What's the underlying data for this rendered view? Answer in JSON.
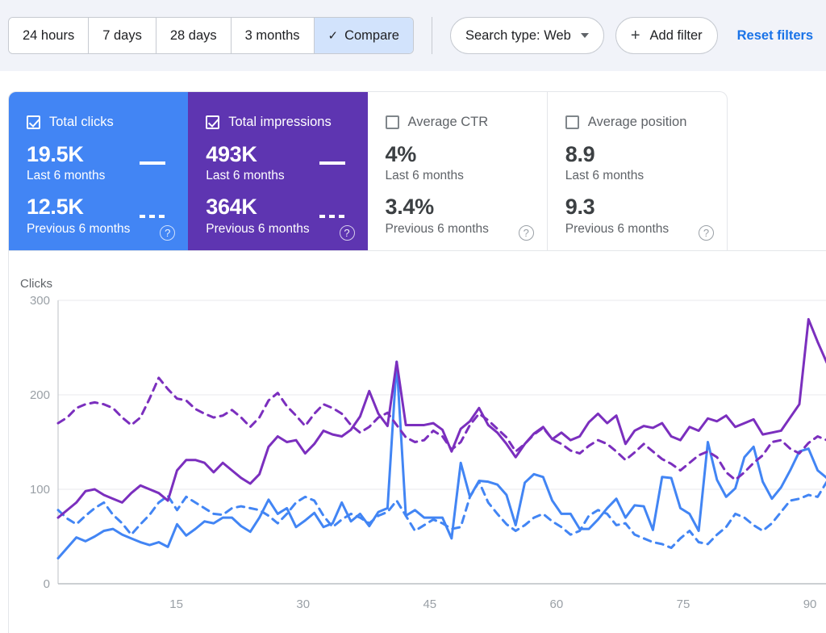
{
  "toolbar": {
    "ranges": [
      {
        "label": "24 hours",
        "active": false
      },
      {
        "label": "7 days",
        "active": false
      },
      {
        "label": "28 days",
        "active": false
      },
      {
        "label": "3 months",
        "active": false
      }
    ],
    "compare_label": "Compare",
    "compare_check_glyph": "✓",
    "search_type_label": "Search type: Web",
    "add_filter_label": "Add filter",
    "add_filter_glyph": "+",
    "reset_label": "Reset filters"
  },
  "cards": [
    {
      "title": "Total clicks",
      "checked": true,
      "theme": "sel-blue",
      "current_value": "19.5K",
      "current_sub": "Last 6 months",
      "previous_value": "12.5K",
      "previous_sub": "Previous 6 months",
      "help_glyph": "?"
    },
    {
      "title": "Total impressions",
      "checked": true,
      "theme": "sel-purple",
      "current_value": "493K",
      "current_sub": "Last 6 months",
      "previous_value": "364K",
      "previous_sub": "Previous 6 months",
      "help_glyph": "?"
    },
    {
      "title": "Average CTR",
      "checked": false,
      "theme": "plain",
      "current_value": "4%",
      "current_sub": "Last 6 months",
      "previous_value": "3.4%",
      "previous_sub": "Previous 6 months",
      "help_glyph": "?"
    },
    {
      "title": "Average position",
      "checked": false,
      "theme": "plain",
      "current_value": "8.9",
      "current_sub": "Last 6 months",
      "previous_value": "9.3",
      "previous_sub": "Previous 6 months",
      "help_glyph": "?"
    }
  ],
  "colors": {
    "clicks": "#4285f4",
    "impressions": "#7b2fbe",
    "card_blue": "#4285f4",
    "card_purple": "#5e35b1",
    "accent_link": "#1a73e8",
    "compare_active_bg": "#d2e3fc",
    "toolbar_bg": "#f1f3f9",
    "gridline": "#e8eaed"
  },
  "chart_data": {
    "type": "line",
    "title": "",
    "ylabel": "Clicks",
    "xlabel": "",
    "ylim": [
      0,
      300
    ],
    "yticks": [
      0,
      100,
      200,
      300
    ],
    "xlim": [
      1,
      92
    ],
    "xticks": [
      15,
      30,
      45,
      60,
      75,
      90
    ],
    "grid": true,
    "legend_position": "cards-above",
    "series": [
      {
        "name": "Total clicks",
        "color": "#4285f4",
        "style": "solid",
        "values": [
          27,
          38,
          49,
          45,
          50,
          56,
          58,
          52,
          48,
          44,
          41,
          44,
          39,
          63,
          51,
          58,
          66,
          64,
          70,
          70,
          61,
          55,
          70,
          89,
          74,
          80,
          60,
          67,
          75,
          60,
          64,
          86,
          66,
          74,
          61,
          76,
          80,
          235,
          72,
          78,
          70,
          70,
          70,
          48,
          128,
          92,
          109,
          108,
          105,
          94,
          62,
          107,
          116,
          113,
          88,
          74,
          74,
          58,
          58,
          68,
          80,
          90,
          70,
          83,
          82,
          57,
          113,
          112,
          80,
          74,
          56,
          150,
          110,
          92,
          101,
          134,
          145,
          108,
          90,
          102,
          120,
          140,
          143,
          120,
          112
        ]
      },
      {
        "name": "Total clicks (previous period)",
        "color": "#4285f4",
        "style": "dashed",
        "values": [
          78,
          69,
          63,
          72,
          80,
          86,
          73,
          64,
          52,
          63,
          73,
          86,
          93,
          78,
          92,
          86,
          80,
          74,
          73,
          80,
          82,
          80,
          78,
          72,
          64,
          74,
          86,
          92,
          88,
          72,
          60,
          68,
          74,
          70,
          64,
          72,
          76,
          88,
          72,
          56,
          62,
          68,
          64,
          58,
          60,
          92,
          108,
          86,
          74,
          63,
          56,
          62,
          70,
          74,
          66,
          60,
          52,
          56,
          72,
          78,
          74,
          62,
          64,
          52,
          48,
          44,
          42,
          38,
          48,
          56,
          44,
          42,
          52,
          60,
          74,
          70,
          62,
          56,
          64,
          76,
          88,
          90,
          94,
          92,
          108
        ]
      },
      {
        "name": "Total impressions",
        "color": "#7b2fbe",
        "style": "solid",
        "values": [
          70,
          78,
          86,
          98,
          100,
          94,
          90,
          86,
          96,
          104,
          100,
          96,
          88,
          120,
          131,
          131,
          128,
          118,
          128,
          120,
          112,
          106,
          116,
          145,
          156,
          150,
          152,
          138,
          148,
          162,
          158,
          156,
          163,
          177,
          204,
          180,
          167,
          235,
          168,
          168,
          168,
          170,
          163,
          140,
          164,
          172,
          186,
          168,
          160,
          148,
          134,
          148,
          159,
          166,
          153,
          160,
          152,
          156,
          171,
          180,
          170,
          178,
          148,
          162,
          167,
          165,
          170,
          156,
          152,
          166,
          162,
          175,
          172,
          178,
          166,
          170,
          174,
          158,
          160,
          162,
          176,
          190,
          280,
          256,
          234
        ]
      },
      {
        "name": "Total impressions (previous period)",
        "color": "#7b2fbe",
        "style": "dashed",
        "values": [
          170,
          176,
          186,
          190,
          192,
          190,
          186,
          176,
          168,
          176,
          196,
          218,
          206,
          196,
          194,
          185,
          180,
          176,
          178,
          184,
          176,
          166,
          176,
          194,
          202,
          188,
          178,
          167,
          180,
          190,
          186,
          180,
          168,
          160,
          166,
          176,
          181,
          168,
          155,
          150,
          152,
          162,
          156,
          142,
          150,
          168,
          180,
          173,
          164,
          155,
          140,
          148,
          158,
          165,
          153,
          148,
          141,
          138,
          146,
          152,
          148,
          140,
          131,
          139,
          148,
          140,
          132,
          127,
          120,
          128,
          136,
          140,
          134,
          118,
          110,
          118,
          128,
          136,
          150,
          152,
          143,
          138,
          149,
          156,
          152
        ]
      }
    ]
  }
}
